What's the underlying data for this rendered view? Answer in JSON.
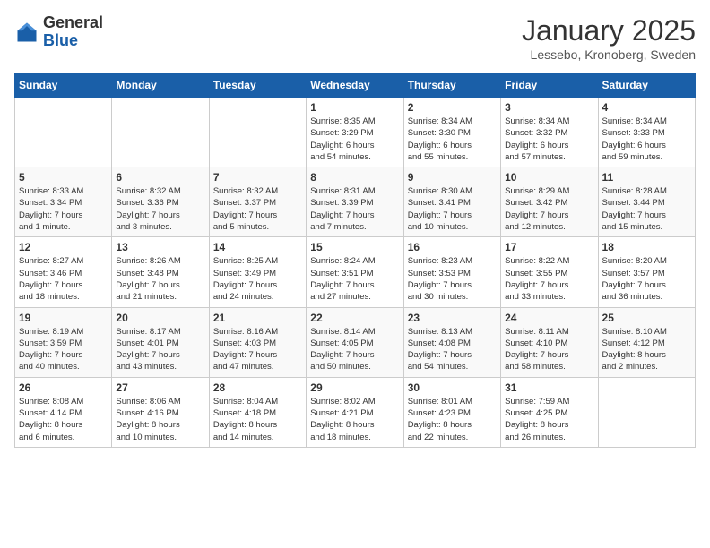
{
  "header": {
    "logo_general": "General",
    "logo_blue": "Blue",
    "month_title": "January 2025",
    "subtitle": "Lessebo, Kronoberg, Sweden"
  },
  "days_of_week": [
    "Sunday",
    "Monday",
    "Tuesday",
    "Wednesday",
    "Thursday",
    "Friday",
    "Saturday"
  ],
  "weeks": [
    [
      {
        "day": "",
        "info": ""
      },
      {
        "day": "",
        "info": ""
      },
      {
        "day": "",
        "info": ""
      },
      {
        "day": "1",
        "info": "Sunrise: 8:35 AM\nSunset: 3:29 PM\nDaylight: 6 hours\nand 54 minutes."
      },
      {
        "day": "2",
        "info": "Sunrise: 8:34 AM\nSunset: 3:30 PM\nDaylight: 6 hours\nand 55 minutes."
      },
      {
        "day": "3",
        "info": "Sunrise: 8:34 AM\nSunset: 3:32 PM\nDaylight: 6 hours\nand 57 minutes."
      },
      {
        "day": "4",
        "info": "Sunrise: 8:34 AM\nSunset: 3:33 PM\nDaylight: 6 hours\nand 59 minutes."
      }
    ],
    [
      {
        "day": "5",
        "info": "Sunrise: 8:33 AM\nSunset: 3:34 PM\nDaylight: 7 hours\nand 1 minute."
      },
      {
        "day": "6",
        "info": "Sunrise: 8:32 AM\nSunset: 3:36 PM\nDaylight: 7 hours\nand 3 minutes."
      },
      {
        "day": "7",
        "info": "Sunrise: 8:32 AM\nSunset: 3:37 PM\nDaylight: 7 hours\nand 5 minutes."
      },
      {
        "day": "8",
        "info": "Sunrise: 8:31 AM\nSunset: 3:39 PM\nDaylight: 7 hours\nand 7 minutes."
      },
      {
        "day": "9",
        "info": "Sunrise: 8:30 AM\nSunset: 3:41 PM\nDaylight: 7 hours\nand 10 minutes."
      },
      {
        "day": "10",
        "info": "Sunrise: 8:29 AM\nSunset: 3:42 PM\nDaylight: 7 hours\nand 12 minutes."
      },
      {
        "day": "11",
        "info": "Sunrise: 8:28 AM\nSunset: 3:44 PM\nDaylight: 7 hours\nand 15 minutes."
      }
    ],
    [
      {
        "day": "12",
        "info": "Sunrise: 8:27 AM\nSunset: 3:46 PM\nDaylight: 7 hours\nand 18 minutes."
      },
      {
        "day": "13",
        "info": "Sunrise: 8:26 AM\nSunset: 3:48 PM\nDaylight: 7 hours\nand 21 minutes."
      },
      {
        "day": "14",
        "info": "Sunrise: 8:25 AM\nSunset: 3:49 PM\nDaylight: 7 hours\nand 24 minutes."
      },
      {
        "day": "15",
        "info": "Sunrise: 8:24 AM\nSunset: 3:51 PM\nDaylight: 7 hours\nand 27 minutes."
      },
      {
        "day": "16",
        "info": "Sunrise: 8:23 AM\nSunset: 3:53 PM\nDaylight: 7 hours\nand 30 minutes."
      },
      {
        "day": "17",
        "info": "Sunrise: 8:22 AM\nSunset: 3:55 PM\nDaylight: 7 hours\nand 33 minutes."
      },
      {
        "day": "18",
        "info": "Sunrise: 8:20 AM\nSunset: 3:57 PM\nDaylight: 7 hours\nand 36 minutes."
      }
    ],
    [
      {
        "day": "19",
        "info": "Sunrise: 8:19 AM\nSunset: 3:59 PM\nDaylight: 7 hours\nand 40 minutes."
      },
      {
        "day": "20",
        "info": "Sunrise: 8:17 AM\nSunset: 4:01 PM\nDaylight: 7 hours\nand 43 minutes."
      },
      {
        "day": "21",
        "info": "Sunrise: 8:16 AM\nSunset: 4:03 PM\nDaylight: 7 hours\nand 47 minutes."
      },
      {
        "day": "22",
        "info": "Sunrise: 8:14 AM\nSunset: 4:05 PM\nDaylight: 7 hours\nand 50 minutes."
      },
      {
        "day": "23",
        "info": "Sunrise: 8:13 AM\nSunset: 4:08 PM\nDaylight: 7 hours\nand 54 minutes."
      },
      {
        "day": "24",
        "info": "Sunrise: 8:11 AM\nSunset: 4:10 PM\nDaylight: 7 hours\nand 58 minutes."
      },
      {
        "day": "25",
        "info": "Sunrise: 8:10 AM\nSunset: 4:12 PM\nDaylight: 8 hours\nand 2 minutes."
      }
    ],
    [
      {
        "day": "26",
        "info": "Sunrise: 8:08 AM\nSunset: 4:14 PM\nDaylight: 8 hours\nand 6 minutes."
      },
      {
        "day": "27",
        "info": "Sunrise: 8:06 AM\nSunset: 4:16 PM\nDaylight: 8 hours\nand 10 minutes."
      },
      {
        "day": "28",
        "info": "Sunrise: 8:04 AM\nSunset: 4:18 PM\nDaylight: 8 hours\nand 14 minutes."
      },
      {
        "day": "29",
        "info": "Sunrise: 8:02 AM\nSunset: 4:21 PM\nDaylight: 8 hours\nand 18 minutes."
      },
      {
        "day": "30",
        "info": "Sunrise: 8:01 AM\nSunset: 4:23 PM\nDaylight: 8 hours\nand 22 minutes."
      },
      {
        "day": "31",
        "info": "Sunrise: 7:59 AM\nSunset: 4:25 PM\nDaylight: 8 hours\nand 26 minutes."
      },
      {
        "day": "",
        "info": ""
      }
    ]
  ]
}
